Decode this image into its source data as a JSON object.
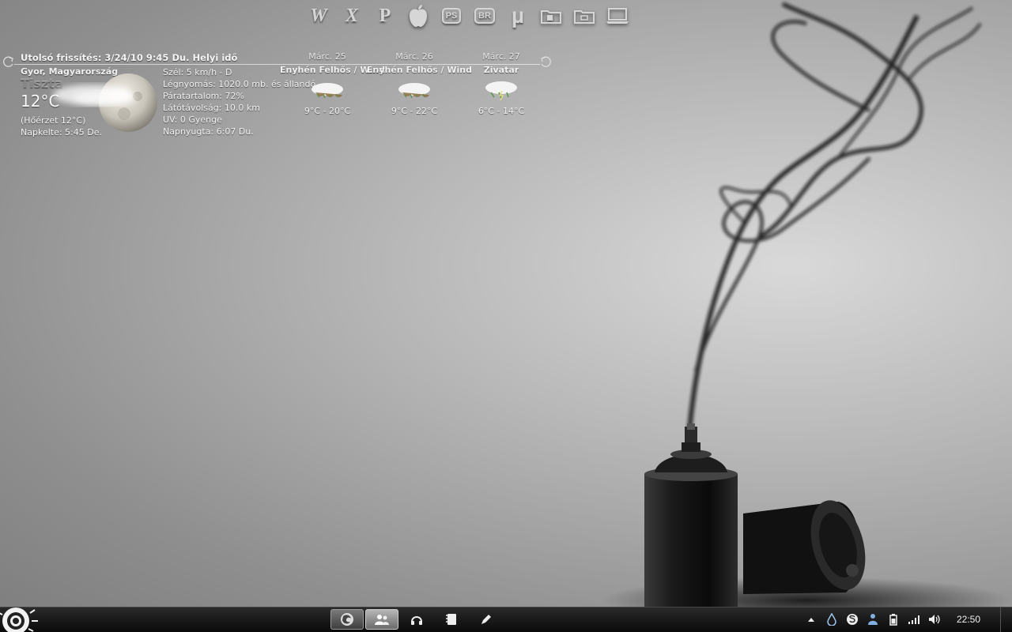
{
  "dock": {
    "items": [
      {
        "id": "word",
        "glyph": "W"
      },
      {
        "id": "excel",
        "glyph": "X"
      },
      {
        "id": "powerpoint",
        "glyph": "P"
      },
      {
        "id": "apple",
        "glyph": ""
      },
      {
        "id": "photoshop",
        "box": "PS"
      },
      {
        "id": "bridge",
        "box": "BR"
      },
      {
        "id": "utorrent",
        "glyph": "µ"
      },
      {
        "id": "documents-folder",
        "glyph": ""
      },
      {
        "id": "folder",
        "glyph": ""
      },
      {
        "id": "laptop",
        "glyph": ""
      }
    ]
  },
  "weather": {
    "last_update": "Utolsó frissítés: 3/24/10 9:45 Du. Helyi idő",
    "location": "Gyor, Magyarország",
    "condition": "Tiszta",
    "temperature": "12°C",
    "feels_like": "(Hőérzet 12°C)",
    "sunrise": "Napkelte: 5:45 De.",
    "details": {
      "wind": "Szél: 5 km/h - D",
      "pressure": "Légnyomás: 1020.0 mb. és állandó",
      "humidity": "Páratartalom: 72%",
      "visibility": "Látótávolság: 10.0 km",
      "uv": "UV: 0 Gyenge",
      "sunset": "Napnyugta: 6:07 Du."
    },
    "forecast": [
      {
        "date": "Márc. 25",
        "condition": "Enyhén Felhős / Wind",
        "range": "9°C - 20°C"
      },
      {
        "date": "Márc. 26",
        "condition": "Enyhén Felhős / Wind",
        "range": "9°C - 22°C"
      },
      {
        "date": "Márc. 27",
        "condition": "Zivatar",
        "range": "6°C - 14°C"
      }
    ]
  },
  "taskbar": {
    "buttons": [
      {
        "id": "firefox",
        "icon": "firefox-icon"
      },
      {
        "id": "messenger",
        "icon": "messenger-icon"
      },
      {
        "id": "headphones",
        "icon": "headphones-icon"
      },
      {
        "id": "notes",
        "icon": "notes-icon"
      },
      {
        "id": "pen",
        "icon": "pen-icon"
      }
    ],
    "tray": [
      "show-hidden-arrow",
      "water-drop-icon",
      "skype-icon",
      "network-user-icon",
      "battery-icon",
      "signal-icon",
      "volume-icon"
    ],
    "clock": "22:50"
  }
}
